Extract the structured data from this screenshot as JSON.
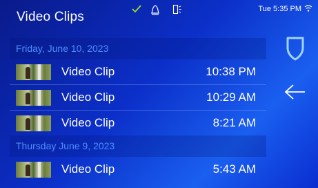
{
  "header": {
    "title": "Video Clips",
    "time": "Tue 5:35 PM"
  },
  "colors": {
    "accent": "#4f8dff",
    "check": "#9be02a"
  },
  "status_icons": [
    "check-icon",
    "alarm-bell-icon",
    "door-sensor-icon",
    "wifi-icon"
  ],
  "groups": [
    {
      "date": "Friday, June 10, 2023",
      "clips": [
        {
          "label": "Video Clip",
          "time": "10:38 PM"
        },
        {
          "label": "Video Clip",
          "time": "10:29 AM"
        },
        {
          "label": "Video Clip",
          "time": "8:21 AM"
        }
      ]
    },
    {
      "date": "Thursday June 9, 2023",
      "clips": [
        {
          "label": "Video Clip",
          "time": "5:43 AM"
        }
      ]
    }
  ],
  "side": {
    "shield": "shield-icon",
    "back": "back-arrow-icon"
  }
}
